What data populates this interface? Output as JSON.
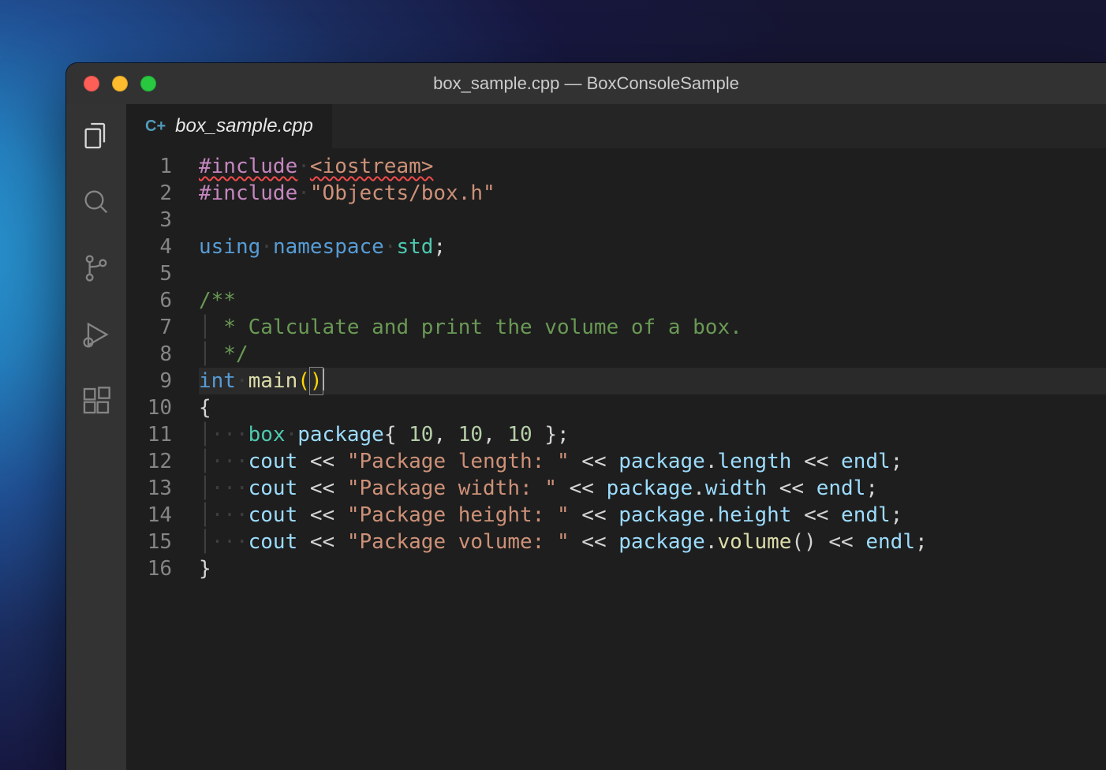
{
  "window": {
    "title": "box_sample.cpp — BoxConsoleSample"
  },
  "tab": {
    "icon_label": "C+",
    "filename": "box_sample.cpp"
  },
  "activity": {
    "explorer": "Explorer",
    "search": "Search",
    "scm": "Source Control",
    "debug": "Run and Debug",
    "extensions": "Extensions"
  },
  "code": {
    "line_count": 16,
    "include1_dir": "#include",
    "include1_hdr": "<iostream>",
    "include2_dir": "#include",
    "include2_hdr": "\"Objects/box.h\"",
    "using_kw": "using",
    "namespace_kw": "namespace",
    "std_id": "std",
    "comment_open": "/**",
    "comment_mid": " * Calculate and print the volume of a box.",
    "comment_close": " */",
    "int_kw": "int",
    "main_fn": "main",
    "open_brace": "{",
    "box_type": "box",
    "pkg_ident": "package",
    "init_list_open": "{ ",
    "ten_a": "10",
    "comma_sp": ", ",
    "ten_b": "10",
    "ten_c": "10",
    "init_list_close": " }",
    "semi": ";",
    "cout": "cout",
    "lshift": " << ",
    "str_len": "\"Package length: \"",
    "str_wid": "\"Package width: \"",
    "str_hei": "\"Package height: \"",
    "str_vol": "\"Package volume: \"",
    "dot": ".",
    "length_m": "length",
    "width_m": "width",
    "height_m": "height",
    "volume_m": "volume",
    "endl": "endl",
    "close_brace": "}",
    "parens": "()"
  },
  "linenums": [
    "1",
    "2",
    "3",
    "4",
    "5",
    "6",
    "7",
    "8",
    "9",
    "10",
    "11",
    "12",
    "13",
    "14",
    "15",
    "16"
  ]
}
